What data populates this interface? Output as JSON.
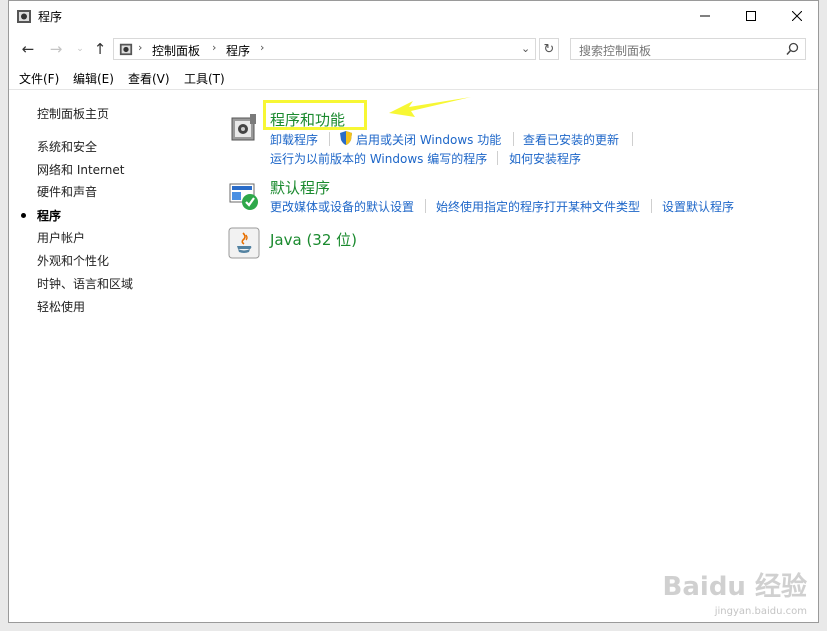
{
  "window": {
    "title": "程序",
    "icons": {
      "app": "control-panel-icon"
    }
  },
  "address": {
    "crumbs": [
      "控制面板",
      "程序"
    ],
    "search_placeholder": "搜索控制面板"
  },
  "menubar": [
    "文件(F)",
    "编辑(E)",
    "查看(V)",
    "工具(T)"
  ],
  "sidebar": {
    "home": "控制面板主页",
    "items": [
      "系统和安全",
      "网络和 Internet",
      "硬件和声音",
      "程序",
      "用户帐户",
      "外观和个性化",
      "时钟、语言和区域",
      "轻松使用"
    ],
    "current": "程序"
  },
  "categories": [
    {
      "title": "程序和功能",
      "links_row1": [
        "卸载程序",
        "启用或关闭 Windows 功能",
        "查看已安装的更新"
      ],
      "links_row2": [
        "运行为以前版本的 Windows 编写的程序",
        "如何安装程序"
      ]
    },
    {
      "title": "默认程序",
      "links_row1": [
        "更改媒体或设备的默认设置",
        "始终使用指定的程序打开某种文件类型",
        "设置默认程序"
      ]
    },
    {
      "title": "Java (32 位)"
    }
  ],
  "watermark": {
    "text": "Baidu 经验",
    "sub": "jingyan.baidu.com"
  },
  "colors": {
    "link": "#1d66c8",
    "category": "#1a8a2e",
    "highlight": "#f7f734"
  }
}
